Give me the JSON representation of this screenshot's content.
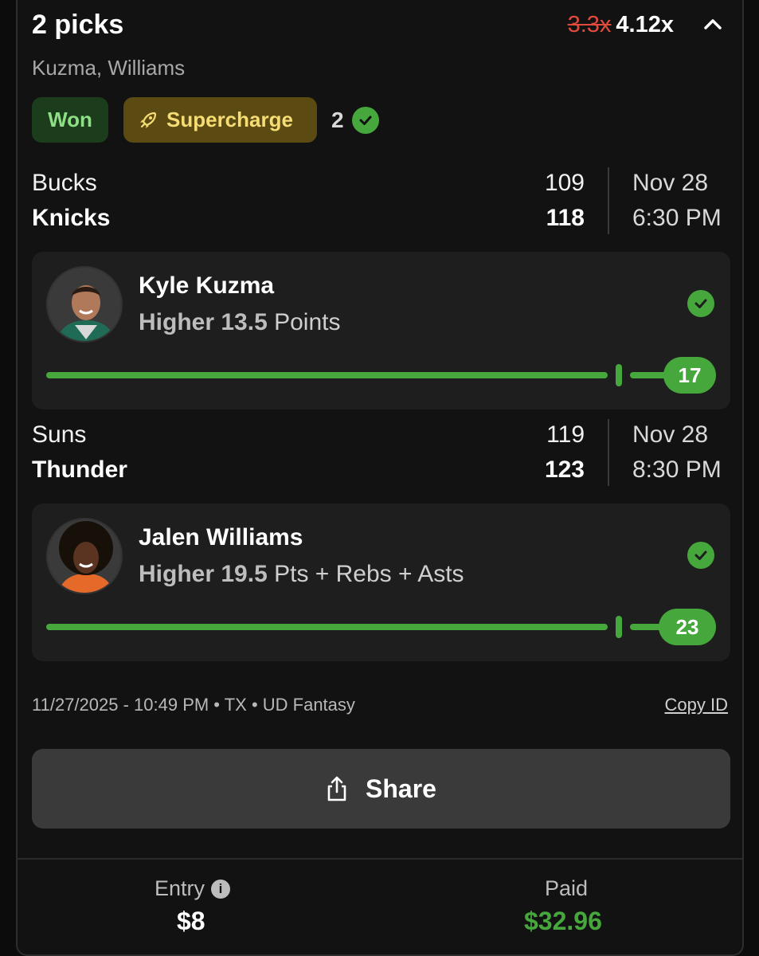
{
  "header": {
    "title": "2 picks",
    "old_multiplier": "3.3x",
    "new_multiplier": "4.12x",
    "players": "Kuzma, Williams"
  },
  "badges": {
    "won": "Won",
    "supercharge": "Supercharge",
    "correct_count": "2"
  },
  "games": [
    {
      "away_team": "Bucks",
      "away_score": "109",
      "home_team": "Knicks",
      "home_score": "118",
      "date": "Nov 28",
      "time": "6:30 PM",
      "pick": {
        "player": "Kyle Kuzma",
        "direction": "Higher",
        "line": "13.5",
        "stat": "Points",
        "result": "17",
        "status": "hit"
      }
    },
    {
      "away_team": "Suns",
      "away_score": "119",
      "home_team": "Thunder",
      "home_score": "123",
      "date": "Nov 28",
      "time": "8:30 PM",
      "pick": {
        "player": "Jalen Williams",
        "direction": "Higher",
        "line": "19.5",
        "stat": "Pts + Rebs + Asts",
        "result": "23",
        "status": "hit"
      }
    }
  ],
  "meta": {
    "info": "11/27/2025 - 10:49 PM • TX • UD Fantasy",
    "copy_id": "Copy ID"
  },
  "share_label": "Share",
  "footer": {
    "entry_label": "Entry",
    "entry_value": "$8",
    "paid_label": "Paid",
    "paid_value": "$32.96"
  },
  "colors": {
    "accent_green": "#46a83c",
    "strike_red": "#e04b3c",
    "won_bg": "#1c3d1c",
    "supercharge_bg": "#5b4a12"
  },
  "icons": [
    "chevron-up-icon",
    "rocket-icon",
    "check-circle-icon",
    "share-icon",
    "info-icon"
  ]
}
